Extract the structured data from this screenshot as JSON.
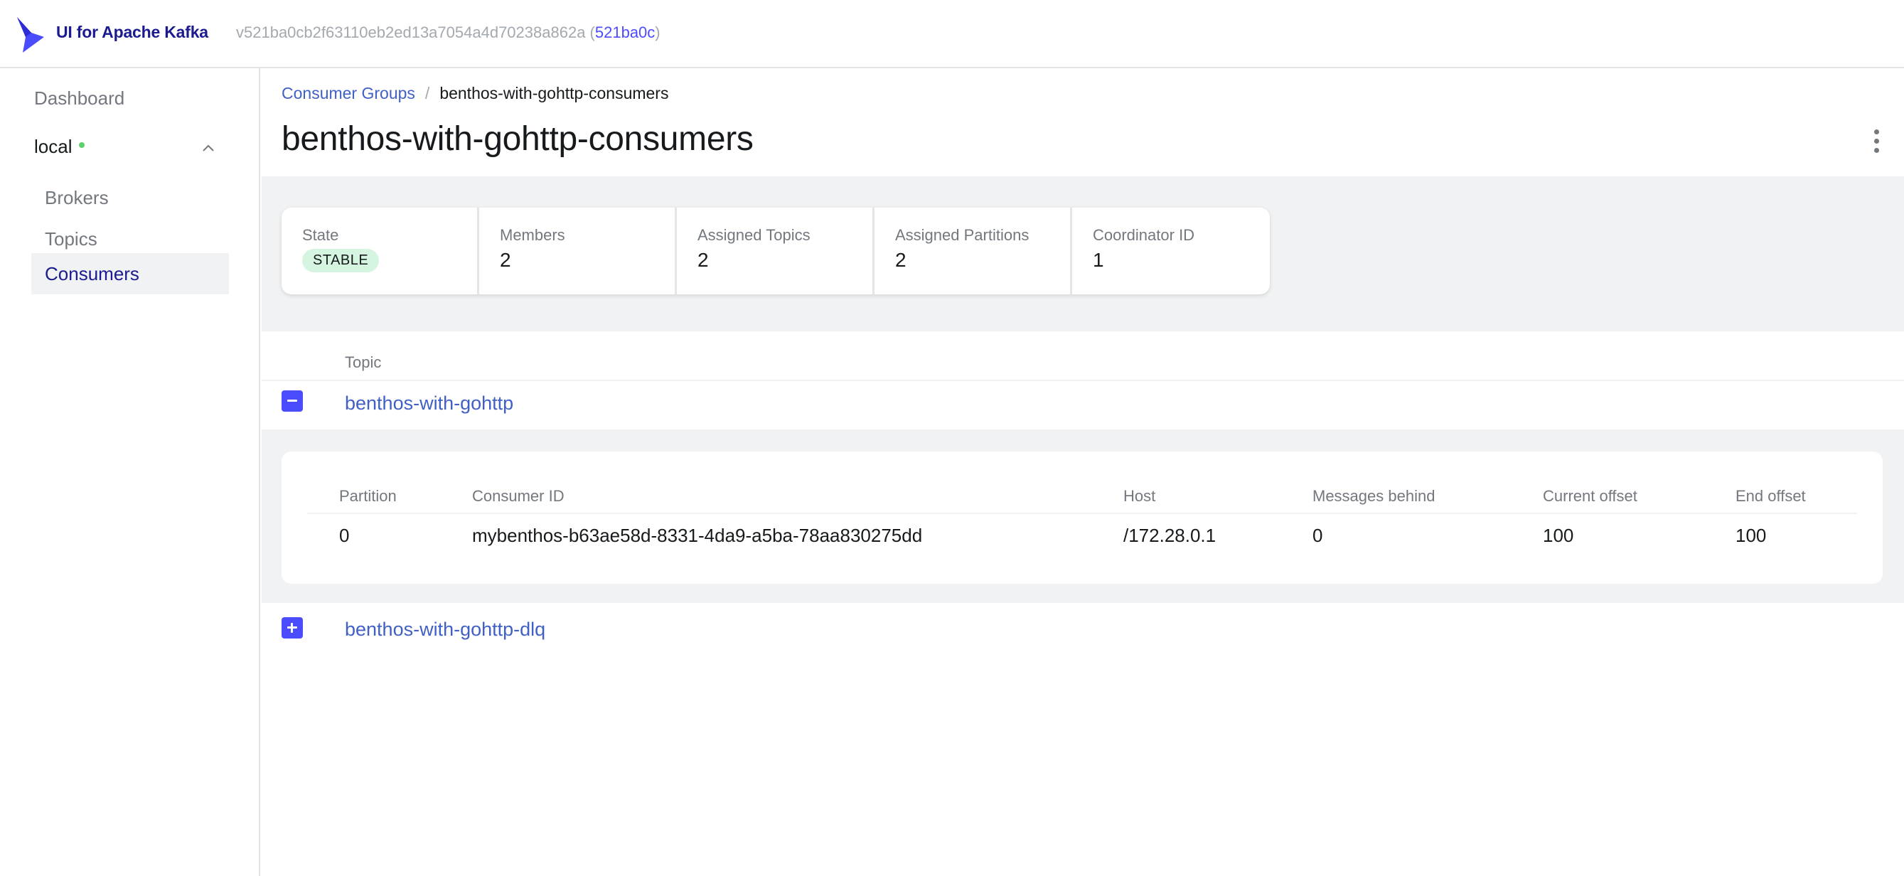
{
  "header": {
    "brand": "UI for Apache Kafka",
    "version_prefix": "v521ba0cb2f63110eb2ed13a7054a4d70238a862a (",
    "version_link": "521ba0c",
    "version_suffix": ")"
  },
  "sidebar": {
    "dashboard": "Dashboard",
    "cluster": "local",
    "items": [
      {
        "label": "Brokers"
      },
      {
        "label": "Topics"
      },
      {
        "label": "Consumers"
      }
    ]
  },
  "breadcrumb": {
    "parent": "Consumer Groups",
    "separator": "/",
    "current": "benthos-with-gohttp-consumers"
  },
  "page": {
    "title": "benthos-with-gohttp-consumers"
  },
  "stats": [
    {
      "label": "State",
      "value": "STABLE"
    },
    {
      "label": "Members",
      "value": "2"
    },
    {
      "label": "Assigned Topics",
      "value": "2"
    },
    {
      "label": "Assigned Partitions",
      "value": "2"
    },
    {
      "label": "Coordinator ID",
      "value": "1"
    }
  ],
  "topics_table": {
    "header": "Topic",
    "rows": [
      {
        "name": "benthos-with-gohttp",
        "expanded": true
      },
      {
        "name": "benthos-with-gohttp-dlq",
        "expanded": false
      }
    ]
  },
  "partition_table": {
    "headers": [
      "Partition",
      "Consumer ID",
      "Host",
      "Messages behind",
      "Current offset",
      "End offset"
    ],
    "rows": [
      [
        "0",
        "mybenthos-b63ae58d-8331-4da9-a5ba-78aa830275dd",
        "/172.28.0.1",
        "0",
        "100",
        "100"
      ]
    ]
  },
  "colors": {
    "accent": "#4c4cff",
    "brand": "#1b1b8f",
    "link": "#4060c6",
    "status_ok": "#5ad16b",
    "badge_bg": "#d6f5e0"
  }
}
